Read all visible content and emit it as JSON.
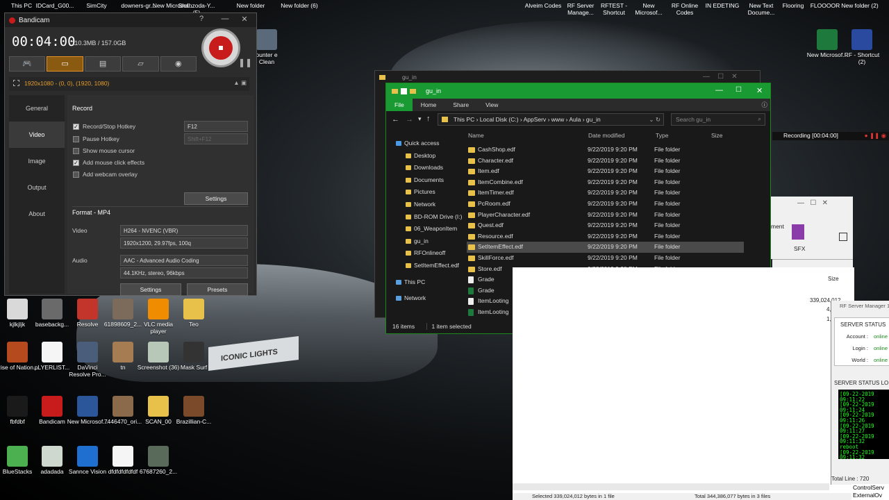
{
  "top_icons": [
    "This PC",
    "IDCard_G00...",
    "SimCity",
    "downers-gr...",
    "New Microsof...",
    "Shahzoda-Y... (5)",
    "New folder",
    "New folder (6)"
  ],
  "top_right_icons": [
    "Alveim Codes",
    "RF Server Manage...",
    "RFTEST - Shortcut",
    "New Microsof...",
    "RF Online Codes",
    "IN EDETING",
    "New Text Docume...",
    "Flooring",
    "FLOOOOR",
    "New folder (2)"
  ],
  "right_desktop_icons": [
    "New Microsof...",
    "RF - Shortcut (2)"
  ],
  "cs_icon": "ounter e Clean",
  "desktop_icons": [
    {
      "label": "kjlkjljk",
      "color": "#d9d9d9"
    },
    {
      "label": "basebackg...",
      "color": "#6a6a6a"
    },
    {
      "label": "Resolve",
      "color": "#c3342b"
    },
    {
      "label": "61898609_2...",
      "color": "#7c6a5a"
    },
    {
      "label": "VLC media player",
      "color": "#f08c00"
    },
    {
      "label": "Teo",
      "color": "#e8c14a"
    },
    {
      "label": "Rise of Nation...",
      "color": "#b44a1e"
    },
    {
      "label": "pLYERLIST...",
      "color": "#f5f5f5"
    },
    {
      "label": "DaVinci Resolve Pro...",
      "color": "#4a5d7a"
    },
    {
      "label": "tn",
      "color": "#a67c52"
    },
    {
      "label": "Screenshot (36)",
      "color": "#b8c8b8"
    },
    {
      "label": "Mask Surf",
      "color": "#333333"
    },
    {
      "label": "fbfdbf",
      "color": "#1a1a1a"
    },
    {
      "label": "Bandicam",
      "color": "#c81b1b"
    },
    {
      "label": "New Microsof...",
      "color": "#2b579a"
    },
    {
      "label": "7446470_ori...",
      "color": "#8a6a4a"
    },
    {
      "label": "SCAN_00",
      "color": "#e8c14a"
    },
    {
      "label": "Brazillian-C...",
      "color": "#7a4a2a"
    },
    {
      "label": "BlueStacks",
      "color": "#4caf50"
    },
    {
      "label": "adadada",
      "color": "#cfd8cf"
    },
    {
      "label": "Sannce Vision",
      "color": "#1e6fd0"
    },
    {
      "label": "dfdfdfdfdfdf",
      "color": "#f5f5f5"
    },
    {
      "label": "67687260_2...",
      "color": "#5a6a5a"
    }
  ],
  "car_plate": "ICONIC LIGHTS",
  "bandicam": {
    "title": "Bandicam",
    "help": "?",
    "minimize": "—",
    "close": "✕",
    "elapsed": "00:04:00",
    "size": "110.3MB / 157.0GB",
    "resolution": "1920x1080 - (0, 0), (1920, 1080)",
    "nav": [
      "General",
      "Video",
      "Image",
      "Output",
      "About"
    ],
    "section": "Record",
    "hotkey_label": "Record/Stop Hotkey",
    "hotkey_value": "F12",
    "pause_label": "Pause Hotkey",
    "pause_value": "Shift+F12",
    "cursor_label": "Show mouse cursor",
    "click_label": "Add mouse click effects",
    "webcam_label": "Add webcam overlay",
    "settings": "Settings",
    "format": "Format - MP4",
    "video_label": "Video",
    "video_codec": "H264 - NVENC (VBR)",
    "video_detail": "1920x1200, 29.97fps, 100q",
    "audio_label": "Audio",
    "audio_codec": "AAC - Advanced Audio Coding",
    "audio_detail": "44.1KHz, stereo, 96kbps",
    "settings2": "Settings",
    "presets": "Presets"
  },
  "explorer_back": {
    "title": "gu_in"
  },
  "explorer": {
    "title": "gu_in",
    "tabs": [
      "File",
      "Home",
      "Share",
      "View"
    ],
    "path": [
      "This PC",
      "Local Disk (C:)",
      "AppServ",
      "www",
      "Aula",
      "gu_in"
    ],
    "search_placeholder": "Search gu_in",
    "columns": [
      "Name",
      "Date modified",
      "Type",
      "Size"
    ],
    "tree": [
      "Quick access",
      "Desktop",
      "Downloads",
      "Documents",
      "Pictures",
      "Network",
      "BD-ROM Drive (I:)",
      "06_WeaponItem",
      "gu_in",
      "RFOnlineoff",
      "SetItemEffect.edf",
      "This PC",
      "Network"
    ],
    "files": [
      {
        "name": "CashShop.edf",
        "date": "9/22/2019 9:20 PM",
        "type": "File folder",
        "size": "",
        "kind": "folder"
      },
      {
        "name": "Character.edf",
        "date": "9/22/2019 9:20 PM",
        "type": "File folder",
        "size": "",
        "kind": "folder"
      },
      {
        "name": "Item.edf",
        "date": "9/22/2019 9:20 PM",
        "type": "File folder",
        "size": "",
        "kind": "folder"
      },
      {
        "name": "ItemCombine.edf",
        "date": "9/22/2019 9:20 PM",
        "type": "File folder",
        "size": "",
        "kind": "folder"
      },
      {
        "name": "ItemTimer.edf",
        "date": "9/22/2019 9:20 PM",
        "type": "File folder",
        "size": "",
        "kind": "folder"
      },
      {
        "name": "PcRoom.edf",
        "date": "9/22/2019 9:20 PM",
        "type": "File folder",
        "size": "",
        "kind": "folder"
      },
      {
        "name": "PlayerCharacter.edf",
        "date": "9/22/2019 9:20 PM",
        "type": "File folder",
        "size": "",
        "kind": "folder"
      },
      {
        "name": "Quest.edf",
        "date": "9/22/2019 9:20 PM",
        "type": "File folder",
        "size": "",
        "kind": "folder"
      },
      {
        "name": "Resource.edf",
        "date": "9/22/2019 9:20 PM",
        "type": "File folder",
        "size": "",
        "kind": "folder"
      },
      {
        "name": "SetItemEffect.edf",
        "date": "9/22/2019 9:20 PM",
        "type": "File folder",
        "size": "",
        "kind": "folder"
      },
      {
        "name": "SkillForce.edf",
        "date": "9/22/2019 9:20 PM",
        "type": "File folder",
        "size": "",
        "kind": "folder"
      },
      {
        "name": "Store.edf",
        "date": "9/22/2019 9:20 PM",
        "type": "File folder",
        "size": "",
        "kind": "folder"
      },
      {
        "name": "Grade",
        "date": "10/22/2012 7:37 AM",
        "type": "Text Document",
        "size": "5 KB",
        "kind": "txt"
      },
      {
        "name": "Grade",
        "date": "10/22/2012 7:37 AM",
        "type": "Microsoft Excel W...",
        "size": "13 KB",
        "kind": "xl"
      },
      {
        "name": "ItemLooting",
        "date": "3/15/2011 7:42 AM",
        "type": "Text Document",
        "size": "5,902 KB",
        "kind": "txt"
      },
      {
        "name": "ItemLooting",
        "date": "10/19/2012 9:40 AM",
        "type": "Microsoft Excel W...",
        "size": "7,039 KB",
        "kind": "xl"
      }
    ],
    "items": "16 items",
    "selected": "1 item selected"
  },
  "recording_bar": "Recording [00:04:00]",
  "white_window": {
    "labels": [
      "ment",
      "SFX"
    ],
    "size_col": "Size",
    "sizes": [
      "339,024,012",
      "4,074",
      "1,288"
    ],
    "status_left": "Selected 339,024,012 bytes in 1 file",
    "status_right": "Total 344,386,077 bytes in 3 files"
  },
  "rf_server": {
    "title": "RF Server Manager 1",
    "status": "SERVER STATUS",
    "rows": [
      {
        "label": "Account :",
        "value": "online"
      },
      {
        "label": "Login :",
        "value": "online"
      },
      {
        "label": "World :",
        "value": "online"
      }
    ],
    "log_title": "SERVER STATUS LO",
    "log": [
      "[09-22-2019 09:11:22",
      "[09-22-2019 09:11:24",
      "[09-22-2019 09:11:26",
      "[09-22-2019 09:11:27",
      "[09-22-2019 09:11:32",
      "reboot",
      "[09-22-2019 09:11:32",
      "[09-22-2019 09:11:47",
      "[09-22-2019 09:15:54"
    ],
    "total": "Total Line :  720",
    "control": "ControlServ",
    "external": "ExternalOv"
  }
}
